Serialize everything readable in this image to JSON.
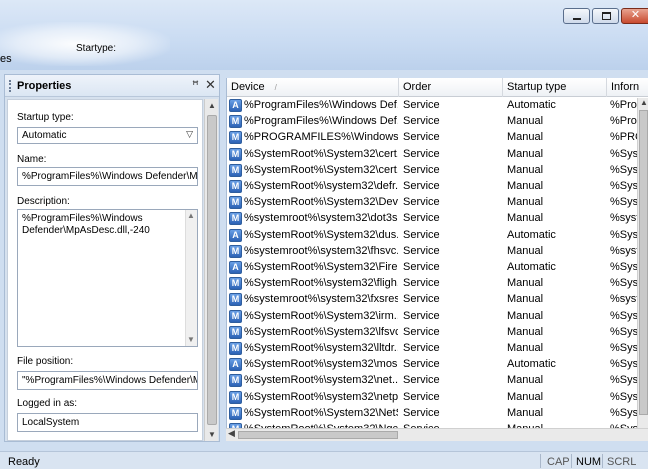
{
  "window": {
    "left_label": "es",
    "startup_type_label": "Startype:"
  },
  "properties": {
    "title": "Properties",
    "startup_type_label": "Startup type:",
    "startup_type_value": "Automatic",
    "name_label": "Name:",
    "name_value": "%ProgramFiles%\\Windows Defender\\MpA",
    "description_label": "Description:",
    "description_value": "%ProgramFiles%\\Windows Defender\\MpAsDesc.dll,-240",
    "file_position_label": "File position:",
    "file_position_value": "\"%ProgramFiles%\\Windows Defender\\Msl",
    "logged_in_label": "Logged in as:",
    "logged_in_value": "LocalSystem"
  },
  "table": {
    "columns": [
      "Device",
      "Order",
      "Startup type",
      "Inforn"
    ],
    "rows": [
      {
        "icon": "A",
        "device": "%ProgramFiles%\\Windows Def...",
        "order": "Service",
        "startup": "Automatic",
        "info": "%Prog"
      },
      {
        "icon": "M",
        "device": "%ProgramFiles%\\Windows Def...",
        "order": "Service",
        "startup": "Manual",
        "info": "%Prog"
      },
      {
        "icon": "M",
        "device": "%PROGRAMFILES%\\Windows ...",
        "order": "Service",
        "startup": "Manual",
        "info": "%PRC"
      },
      {
        "icon": "M",
        "device": "%SystemRoot%\\System32\\cert...",
        "order": "Service",
        "startup": "Manual",
        "info": "%Syst"
      },
      {
        "icon": "M",
        "device": "%SystemRoot%\\System32\\cert...",
        "order": "Service",
        "startup": "Manual",
        "info": "%Syst"
      },
      {
        "icon": "M",
        "device": "%SystemRoot%\\system32\\defr...",
        "order": "Service",
        "startup": "Manual",
        "info": "%Syst"
      },
      {
        "icon": "M",
        "device": "%SystemRoot%\\System32\\Devi...",
        "order": "Service",
        "startup": "Manual",
        "info": "%Syst"
      },
      {
        "icon": "M",
        "device": "%systemroot%\\system32\\dot3s...",
        "order": "Service",
        "startup": "Manual",
        "info": "%syst"
      },
      {
        "icon": "A",
        "device": "%SystemRoot%\\System32\\dus...",
        "order": "Service",
        "startup": "Automatic",
        "info": "%Syst"
      },
      {
        "icon": "M",
        "device": "%systemroot%\\system32\\fhsvc...",
        "order": "Service",
        "startup": "Manual",
        "info": "%syst"
      },
      {
        "icon": "A",
        "device": "%SystemRoot%\\System32\\Fire...",
        "order": "Service",
        "startup": "Automatic",
        "info": "%Syst"
      },
      {
        "icon": "M",
        "device": "%SystemRoot%\\system32\\fligh...",
        "order": "Service",
        "startup": "Manual",
        "info": "%Syst"
      },
      {
        "icon": "M",
        "device": "%systemroot%\\system32\\fxsres...",
        "order": "Service",
        "startup": "Manual",
        "info": "%syst"
      },
      {
        "icon": "M",
        "device": "%SystemRoot%\\System32\\irm...",
        "order": "Service",
        "startup": "Manual",
        "info": "%Syst"
      },
      {
        "icon": "M",
        "device": "%SystemRoot%\\System32\\lfsvc...",
        "order": "Service",
        "startup": "Manual",
        "info": "%Syst"
      },
      {
        "icon": "M",
        "device": "%SystemRoot%\\system32\\lltdr...",
        "order": "Service",
        "startup": "Manual",
        "info": "%Syst"
      },
      {
        "icon": "A",
        "device": "%SystemRoot%\\system32\\mos...",
        "order": "Service",
        "startup": "Automatic",
        "info": "%Syst"
      },
      {
        "icon": "M",
        "device": "%SystemRoot%\\system32\\net...",
        "order": "Service",
        "startup": "Manual",
        "info": "%Syst"
      },
      {
        "icon": "M",
        "device": "%SystemRoot%\\system32\\netp...",
        "order": "Service",
        "startup": "Manual",
        "info": "%Syst"
      },
      {
        "icon": "M",
        "device": "%SystemRoot%\\System32\\NetS...",
        "order": "Service",
        "startup": "Manual",
        "info": "%Syst"
      },
      {
        "icon": "M",
        "device": "%SystemRoot%\\System32\\Ngc...",
        "order": "Service",
        "startup": "Manual",
        "info": "%Syst"
      }
    ]
  },
  "status": {
    "ready": "Ready",
    "cap": "CAP",
    "num": "NUM",
    "scrl": "SCRL"
  }
}
